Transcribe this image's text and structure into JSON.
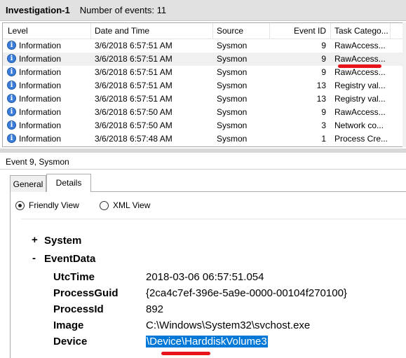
{
  "window": {
    "title": "Investigation-1",
    "event_count_label": "Number of events: 11"
  },
  "columns": [
    "Level",
    "Date and Time",
    "Source",
    "Event ID",
    "Task Catego..."
  ],
  "events": [
    {
      "level": "Information",
      "datetime": "3/6/2018 6:57:51 AM",
      "source": "Sysmon",
      "event_id": "9",
      "task": "RawAccess..."
    },
    {
      "level": "Information",
      "datetime": "3/6/2018 6:57:51 AM",
      "source": "Sysmon",
      "event_id": "9",
      "task": "RawAccess..."
    },
    {
      "level": "Information",
      "datetime": "3/6/2018 6:57:51 AM",
      "source": "Sysmon",
      "event_id": "9",
      "task": "RawAccess..."
    },
    {
      "level": "Information",
      "datetime": "3/6/2018 6:57:51 AM",
      "source": "Sysmon",
      "event_id": "13",
      "task": "Registry val..."
    },
    {
      "level": "Information",
      "datetime": "3/6/2018 6:57:51 AM",
      "source": "Sysmon",
      "event_id": "13",
      "task": "Registry val..."
    },
    {
      "level": "Information",
      "datetime": "3/6/2018 6:57:50 AM",
      "source": "Sysmon",
      "event_id": "9",
      "task": "RawAccess..."
    },
    {
      "level": "Information",
      "datetime": "3/6/2018 6:57:50 AM",
      "source": "Sysmon",
      "event_id": "3",
      "task": "Network co..."
    },
    {
      "level": "Information",
      "datetime": "3/6/2018 6:57:48 AM",
      "source": "Sysmon",
      "event_id": "1",
      "task": "Process Cre..."
    }
  ],
  "level_icon": {
    "name": "info-icon",
    "glyph": "i"
  },
  "detail": {
    "header": "Event 9, Sysmon",
    "tabs": [
      "General",
      "Details"
    ],
    "active_tab": "Details",
    "views": {
      "friendly": "Friendly View",
      "xml": "XML View",
      "selected": "friendly"
    },
    "tree": {
      "system": {
        "toggle": "+",
        "label": "System"
      },
      "eventdata": {
        "toggle": "-",
        "label": "EventData"
      },
      "fields": [
        {
          "key": "UtcTime",
          "value": "2018-03-06 06:57:51.054"
        },
        {
          "key": "ProcessGuid",
          "value": "{2ca4c7ef-396e-5a9e-0000-00104f270100}"
        },
        {
          "key": "ProcessId",
          "value": "892"
        },
        {
          "key": "Image",
          "value": "C:\\Windows\\System32\\svchost.exe"
        },
        {
          "key": "Device",
          "value": "\\Device\\HarddiskVolume3"
        }
      ]
    }
  },
  "colors": {
    "selection": "#0078d7",
    "annotation": "#e8141c",
    "info_icon": "#3b7dd8"
  }
}
